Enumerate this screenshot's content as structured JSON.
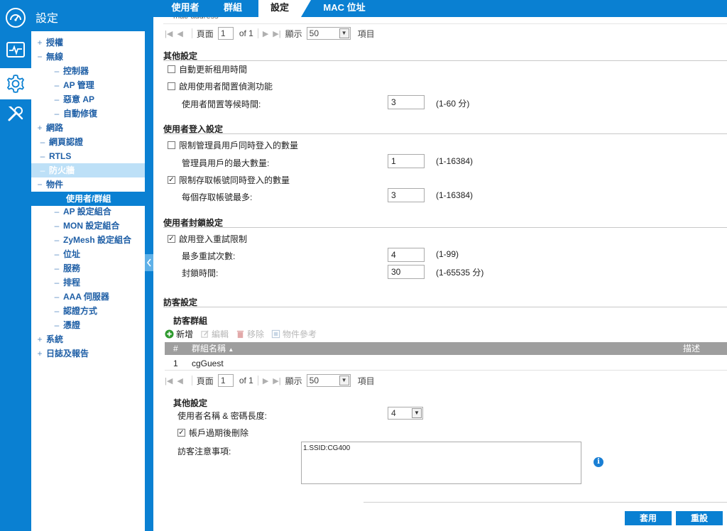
{
  "rail": {
    "items": [
      {
        "name": "dashboard",
        "icon": "gauge-icon"
      },
      {
        "name": "monitor",
        "icon": "pulse-monitor-icon"
      },
      {
        "name": "configuration",
        "icon": "gear-icon"
      },
      {
        "name": "maintenance",
        "icon": "tools-icon"
      }
    ],
    "active": "configuration"
  },
  "nav": {
    "title": "設定",
    "items": [
      {
        "symbol": "+",
        "label": "授權"
      },
      {
        "symbol": "−",
        "label": "無線"
      },
      {
        "symbol": "–",
        "label": "控制器"
      },
      {
        "symbol": "–",
        "label": "AP 管理"
      },
      {
        "symbol": "–",
        "label": "惡意 AP"
      },
      {
        "symbol": "–",
        "label": "自動修復"
      },
      {
        "symbol": "+",
        "label": "網路"
      },
      {
        "symbol": "–",
        "label": "網頁認證"
      },
      {
        "symbol": "–",
        "label": "RTLS"
      },
      {
        "symbol": "–",
        "label": "防火牆"
      },
      {
        "symbol": "−",
        "label": "物件"
      },
      {
        "symbol": "",
        "label": "使用者/群組"
      },
      {
        "symbol": "–",
        "label": "AP 設定組合"
      },
      {
        "symbol": "–",
        "label": "MON 設定組合"
      },
      {
        "symbol": "–",
        "label": "ZyMesh 設定組合"
      },
      {
        "symbol": "–",
        "label": "位址"
      },
      {
        "symbol": "–",
        "label": "服務"
      },
      {
        "symbol": "–",
        "label": "排程"
      },
      {
        "symbol": "–",
        "label": "AAA 伺服器"
      },
      {
        "symbol": "–",
        "label": "認證方式"
      },
      {
        "symbol": "–",
        "label": "憑證"
      },
      {
        "symbol": "+",
        "label": "系統"
      },
      {
        "symbol": "+",
        "label": "日誌及報告"
      }
    ]
  },
  "tabs": [
    "使用者",
    "群組",
    "設定",
    "MAC 位址"
  ],
  "active_tab": "設定",
  "top_partial_row": {
    "text": "mac-address"
  },
  "pager1": {
    "page_label": "頁面",
    "page": "1",
    "of_label": "of 1",
    "show_label": "顯示",
    "per_page": "50",
    "items_label": "項目"
  },
  "other_settings": {
    "title": "其他設定",
    "auto_renew": {
      "label": "自動更新租用時間",
      "checked": false
    },
    "idle_detect": {
      "label": "啟用使用者閒置偵測功能",
      "checked": false
    },
    "idle_wait": {
      "label": "使用者閒置等候時間:",
      "value": "3",
      "range": "(1-60 分)"
    }
  },
  "login_settings": {
    "title": "使用者登入設定",
    "limit_admin": {
      "label": "限制管理員用戶同時登入的數量",
      "checked": false
    },
    "admin_max": {
      "label": "管理員用戶的最大數量:",
      "value": "1",
      "range": "(1-16384)"
    },
    "limit_access": {
      "label": "限制存取帳號同時登入的數量",
      "checked": true
    },
    "access_max": {
      "label": "每個存取帳號最多:",
      "value": "3",
      "range": "(1-16384)"
    }
  },
  "lockout_settings": {
    "title": "使用者封鎖設定",
    "enable_retry": {
      "label": "啟用登入重試限制",
      "checked": true
    },
    "max_retry": {
      "label": "最多重試次數:",
      "value": "4",
      "range": "(1-99)"
    },
    "lockout_time": {
      "label": "封鎖時間:",
      "value": "30",
      "range": "(1-65535 分)"
    }
  },
  "guest_settings": {
    "title": "訪客設定",
    "group_title": "訪客群組",
    "toolbar": {
      "add": "新增",
      "edit": "編輯",
      "remove": "移除",
      "reference": "物件參考"
    },
    "columns": {
      "index": "#",
      "name": "群組名稱",
      "desc": "描述"
    },
    "rows": [
      {
        "index": "1",
        "name": "cgGuest",
        "desc": ""
      }
    ],
    "pager": {
      "page_label": "頁面",
      "page": "1",
      "of_label": "of 1",
      "show_label": "顯示",
      "per_page": "50",
      "items_label": "項目"
    },
    "other_title": "其他設定",
    "name_pw_len": {
      "label": "使用者名稱 & 密碼長度:",
      "value": "4"
    },
    "delete_expired": {
      "label": "帳戶過期後刪除",
      "checked": true
    },
    "notice": {
      "label": "訪客注意事項:",
      "value": "1.SSID:CG400"
    }
  },
  "buttons": {
    "apply": "套用",
    "reset": "重設"
  },
  "colors": {
    "brand": "#0a80d2",
    "selected_nav": "#bde0f7",
    "table_header": "#9e9e9e",
    "info": "#1a7fd4"
  }
}
